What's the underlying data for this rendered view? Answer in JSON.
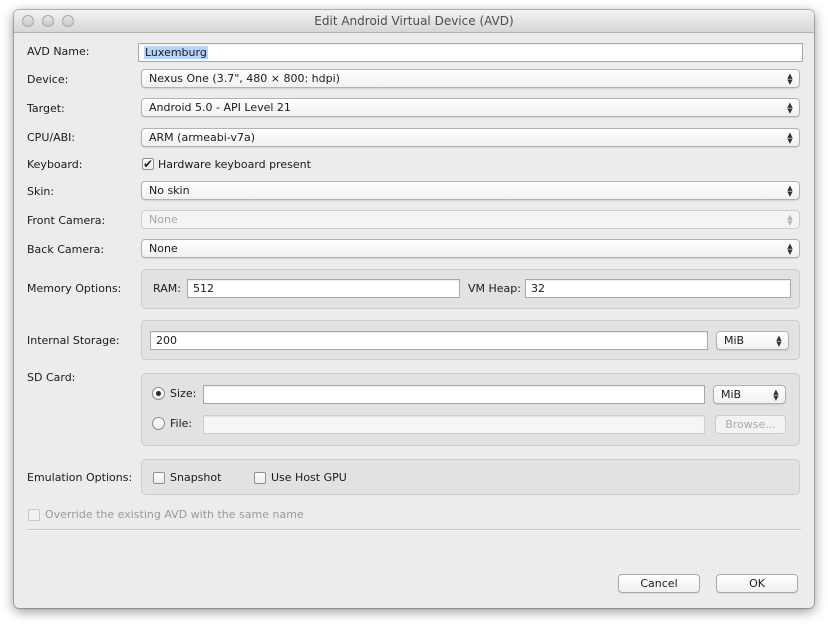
{
  "window": {
    "title": "Edit Android Virtual Device (AVD)"
  },
  "labels": {
    "avd_name": "AVD Name:",
    "device": "Device:",
    "target": "Target:",
    "cpu_abi": "CPU/ABI:",
    "keyboard": "Keyboard:",
    "skin": "Skin:",
    "front_camera": "Front Camera:",
    "back_camera": "Back Camera:",
    "memory_options": "Memory Options:",
    "internal_storage": "Internal Storage:",
    "sd_card": "SD Card:",
    "emulation_options": "Emulation Options:"
  },
  "fields": {
    "avd_name": "Luxemburg",
    "device": "Nexus One (3.7\", 480 × 800: hdpi)",
    "target": "Android 5.0 - API Level 21",
    "cpu_abi": "ARM (armeabi-v7a)",
    "keyboard_checkbox_label": "Hardware keyboard present",
    "keyboard_checked": true,
    "skin": "No skin",
    "front_camera": "None",
    "back_camera": "None"
  },
  "memory": {
    "ram_label": "RAM:",
    "ram_value": "512",
    "vm_heap_label": "VM Heap:",
    "vm_heap_value": "32"
  },
  "internal_storage": {
    "value": "200",
    "unit": "MiB"
  },
  "sd_card": {
    "size_label": "Size:",
    "size_value": "",
    "size_unit": "MiB",
    "size_selected": true,
    "file_label": "File:",
    "file_value": "",
    "browse_label": "Browse..."
  },
  "emulation": {
    "snapshot_label": "Snapshot",
    "snapshot_checked": false,
    "host_gpu_label": "Use Host GPU",
    "host_gpu_checked": false
  },
  "override": {
    "label": "Override the existing AVD with the same name",
    "checked": false
  },
  "buttons": {
    "cancel": "Cancel",
    "ok": "OK"
  },
  "icons": {
    "checkmark": "✔",
    "popup_arrows": "⬍"
  }
}
